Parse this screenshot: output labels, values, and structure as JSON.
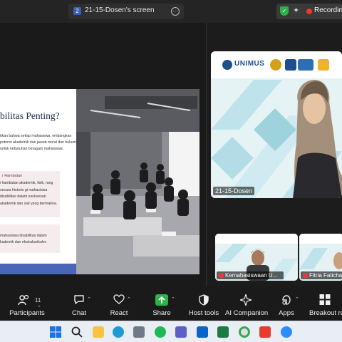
{
  "window": {
    "tab_number": "2",
    "tab_title": "21-15-Dosen's screen",
    "recording_label": "Recording..."
  },
  "slide": {
    "title": "bilitas Penting?",
    "paragraph": "tikan bahwa setiap mahasiswa, embangkan potensi akademik dan jawab moral dan hukum untuk kebutuhan beragam mahasiswa.",
    "box1_heading": "r Hambatan",
    "box1_text": "i hambatan akademik, fisik, rang secara historis gi mahasiswa disabilitas dalam esuksesan akademik dan sial yang bermakna.",
    "box2_text": "mahasiswa disabilitas dalam kademik dan ekstrakurikuler."
  },
  "main_video": {
    "logo_text": "UNIMUS",
    "participant_label": "21-15-Dosen"
  },
  "thumbnails": [
    {
      "label": "Kemahasiswaan U..."
    },
    {
      "label": "Fitria Faticha"
    }
  ],
  "toolbar": {
    "participants_label": "Participants",
    "participants_count": "11",
    "chat_label": "Chat",
    "react_label": "React",
    "share_label": "Share",
    "host_tools_label": "Host tools",
    "ai_companion_label": "AI Companion",
    "apps_label": "Apps",
    "breakout_label": "Breakout roo"
  },
  "colors": {
    "share_green": "#2db14a",
    "record_red": "#e8382f",
    "slide_blue_bar": "#4a66b8",
    "unimus_blue": "#1f4e8c"
  },
  "taskbar_icons": [
    "windows-icon",
    "search-icon",
    "file-explorer-icon",
    "edge-icon",
    "camera-icon",
    "spotify-icon",
    "teams-icon",
    "outlook-icon",
    "excel-icon",
    "chrome-icon",
    "acrobat-icon",
    "zoom-icon"
  ]
}
